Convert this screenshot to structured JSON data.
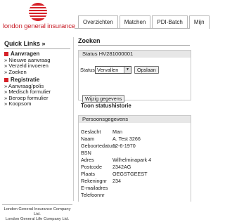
{
  "header": {
    "logo_text": "london general insurance",
    "tabs": [
      "Overzichten",
      "Matchen",
      "PDI-Batch",
      "Mijn"
    ]
  },
  "sidebar": {
    "title": "Quick Links",
    "title_suffix": "»",
    "groups": [
      {
        "label": "Aanvragen",
        "items": [
          "» Nieuwe aanvraag",
          "» Verzeld invoeren",
          "» Zoeken"
        ]
      },
      {
        "label": "Registratie",
        "items": [
          "» Aanvraag/polis",
          "» Medisch formulier",
          "» Beroep formulier",
          "» Koopsom"
        ]
      }
    ],
    "footer": [
      "London General Insurance Company Ltd.",
      "London General Life Company Ltd."
    ]
  },
  "main": {
    "title": "Zoeken",
    "status_panel": {
      "header": "Status HV281000001",
      "status_label": "Status:",
      "status_value": "Vervallen",
      "save_label": "Opslaan",
      "edit_label": "Wijzig gegevens",
      "history_label": "Toon statushistorie"
    },
    "personal_panel": {
      "header": "Persoonsgegevens",
      "fields": [
        {
          "label": "Geslacht",
          "value": "Man"
        },
        {
          "label": "Naam",
          "value": "A. Test 3266"
        },
        {
          "label": "Geboortedatum",
          "value": "12-6-1970"
        },
        {
          "label": "BSN",
          "value": ""
        },
        {
          "label": "Adres",
          "value": "Wilhelminapark 4"
        },
        {
          "label": "Postcode",
          "value": "2342AG"
        },
        {
          "label": "Plaats",
          "value": "OEGSTGEEST"
        },
        {
          "label": "Rekeningnr",
          "value": "234"
        },
        {
          "label": "E-mailadres",
          "value": ""
        },
        {
          "label": "Telefoonnr",
          "value": ""
        }
      ]
    }
  },
  "colors": {
    "brand_red": "#d62128",
    "panel_header": "#e7e7e7"
  }
}
